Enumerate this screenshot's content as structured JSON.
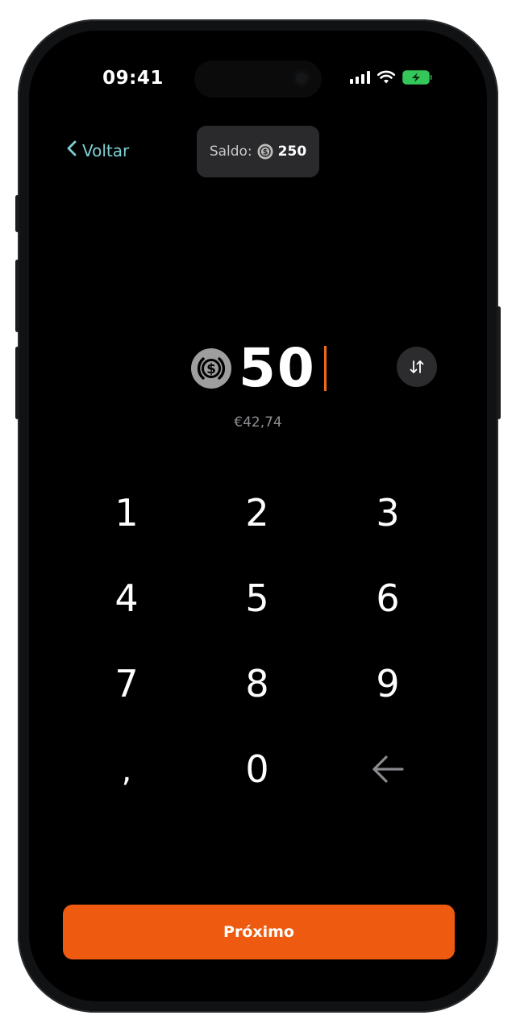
{
  "status_bar": {
    "time": "09:41",
    "icons": [
      "signal-icon",
      "wifi-icon",
      "battery-charging-icon"
    ]
  },
  "nav": {
    "back_label": "Voltar",
    "balance_label": "Saldo:",
    "balance_value": "250",
    "balance_icon": "usdc-coin-icon"
  },
  "amount": {
    "value": "50",
    "fiat_equivalent": "€42,74",
    "currency_icon": "usdc-coin-icon",
    "swap_icon": "swap-vertical-icon"
  },
  "keypad": {
    "keys": [
      "1",
      "2",
      "3",
      "4",
      "5",
      "6",
      "7",
      "8",
      "9",
      ",",
      "0"
    ],
    "backspace_icon": "backspace-arrow-icon"
  },
  "cta": {
    "label": "Próximo"
  },
  "colors": {
    "accent": "#EE5A0F",
    "back_link": "#7FD0D4",
    "background": "#000000",
    "pill": "#2A2A2C",
    "battery": "#34C759"
  }
}
